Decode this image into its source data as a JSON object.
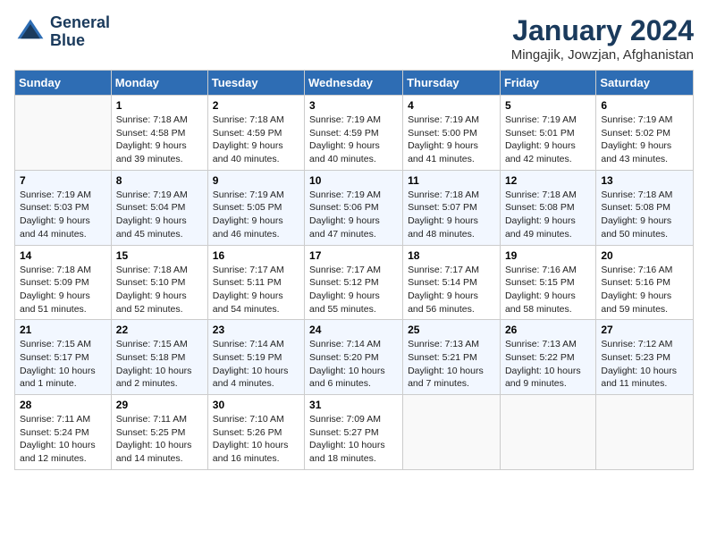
{
  "logo": {
    "line1": "General",
    "line2": "Blue"
  },
  "title": "January 2024",
  "location": "Mingajik, Jowzjan, Afghanistan",
  "weekdays": [
    "Sunday",
    "Monday",
    "Tuesday",
    "Wednesday",
    "Thursday",
    "Friday",
    "Saturday"
  ],
  "weeks": [
    [
      {
        "day": "",
        "sunrise": "",
        "sunset": "",
        "daylight": ""
      },
      {
        "day": "1",
        "sunrise": "Sunrise: 7:18 AM",
        "sunset": "Sunset: 4:58 PM",
        "daylight": "Daylight: 9 hours and 39 minutes."
      },
      {
        "day": "2",
        "sunrise": "Sunrise: 7:18 AM",
        "sunset": "Sunset: 4:59 PM",
        "daylight": "Daylight: 9 hours and 40 minutes."
      },
      {
        "day": "3",
        "sunrise": "Sunrise: 7:19 AM",
        "sunset": "Sunset: 4:59 PM",
        "daylight": "Daylight: 9 hours and 40 minutes."
      },
      {
        "day": "4",
        "sunrise": "Sunrise: 7:19 AM",
        "sunset": "Sunset: 5:00 PM",
        "daylight": "Daylight: 9 hours and 41 minutes."
      },
      {
        "day": "5",
        "sunrise": "Sunrise: 7:19 AM",
        "sunset": "Sunset: 5:01 PM",
        "daylight": "Daylight: 9 hours and 42 minutes."
      },
      {
        "day": "6",
        "sunrise": "Sunrise: 7:19 AM",
        "sunset": "Sunset: 5:02 PM",
        "daylight": "Daylight: 9 hours and 43 minutes."
      }
    ],
    [
      {
        "day": "7",
        "sunrise": "Sunrise: 7:19 AM",
        "sunset": "Sunset: 5:03 PM",
        "daylight": "Daylight: 9 hours and 44 minutes."
      },
      {
        "day": "8",
        "sunrise": "Sunrise: 7:19 AM",
        "sunset": "Sunset: 5:04 PM",
        "daylight": "Daylight: 9 hours and 45 minutes."
      },
      {
        "day": "9",
        "sunrise": "Sunrise: 7:19 AM",
        "sunset": "Sunset: 5:05 PM",
        "daylight": "Daylight: 9 hours and 46 minutes."
      },
      {
        "day": "10",
        "sunrise": "Sunrise: 7:19 AM",
        "sunset": "Sunset: 5:06 PM",
        "daylight": "Daylight: 9 hours and 47 minutes."
      },
      {
        "day": "11",
        "sunrise": "Sunrise: 7:18 AM",
        "sunset": "Sunset: 5:07 PM",
        "daylight": "Daylight: 9 hours and 48 minutes."
      },
      {
        "day": "12",
        "sunrise": "Sunrise: 7:18 AM",
        "sunset": "Sunset: 5:08 PM",
        "daylight": "Daylight: 9 hours and 49 minutes."
      },
      {
        "day": "13",
        "sunrise": "Sunrise: 7:18 AM",
        "sunset": "Sunset: 5:08 PM",
        "daylight": "Daylight: 9 hours and 50 minutes."
      }
    ],
    [
      {
        "day": "14",
        "sunrise": "Sunrise: 7:18 AM",
        "sunset": "Sunset: 5:09 PM",
        "daylight": "Daylight: 9 hours and 51 minutes."
      },
      {
        "day": "15",
        "sunrise": "Sunrise: 7:18 AM",
        "sunset": "Sunset: 5:10 PM",
        "daylight": "Daylight: 9 hours and 52 minutes."
      },
      {
        "day": "16",
        "sunrise": "Sunrise: 7:17 AM",
        "sunset": "Sunset: 5:11 PM",
        "daylight": "Daylight: 9 hours and 54 minutes."
      },
      {
        "day": "17",
        "sunrise": "Sunrise: 7:17 AM",
        "sunset": "Sunset: 5:12 PM",
        "daylight": "Daylight: 9 hours and 55 minutes."
      },
      {
        "day": "18",
        "sunrise": "Sunrise: 7:17 AM",
        "sunset": "Sunset: 5:14 PM",
        "daylight": "Daylight: 9 hours and 56 minutes."
      },
      {
        "day": "19",
        "sunrise": "Sunrise: 7:16 AM",
        "sunset": "Sunset: 5:15 PM",
        "daylight": "Daylight: 9 hours and 58 minutes."
      },
      {
        "day": "20",
        "sunrise": "Sunrise: 7:16 AM",
        "sunset": "Sunset: 5:16 PM",
        "daylight": "Daylight: 9 hours and 59 minutes."
      }
    ],
    [
      {
        "day": "21",
        "sunrise": "Sunrise: 7:15 AM",
        "sunset": "Sunset: 5:17 PM",
        "daylight": "Daylight: 10 hours and 1 minute."
      },
      {
        "day": "22",
        "sunrise": "Sunrise: 7:15 AM",
        "sunset": "Sunset: 5:18 PM",
        "daylight": "Daylight: 10 hours and 2 minutes."
      },
      {
        "day": "23",
        "sunrise": "Sunrise: 7:14 AM",
        "sunset": "Sunset: 5:19 PM",
        "daylight": "Daylight: 10 hours and 4 minutes."
      },
      {
        "day": "24",
        "sunrise": "Sunrise: 7:14 AM",
        "sunset": "Sunset: 5:20 PM",
        "daylight": "Daylight: 10 hours and 6 minutes."
      },
      {
        "day": "25",
        "sunrise": "Sunrise: 7:13 AM",
        "sunset": "Sunset: 5:21 PM",
        "daylight": "Daylight: 10 hours and 7 minutes."
      },
      {
        "day": "26",
        "sunrise": "Sunrise: 7:13 AM",
        "sunset": "Sunset: 5:22 PM",
        "daylight": "Daylight: 10 hours and 9 minutes."
      },
      {
        "day": "27",
        "sunrise": "Sunrise: 7:12 AM",
        "sunset": "Sunset: 5:23 PM",
        "daylight": "Daylight: 10 hours and 11 minutes."
      }
    ],
    [
      {
        "day": "28",
        "sunrise": "Sunrise: 7:11 AM",
        "sunset": "Sunset: 5:24 PM",
        "daylight": "Daylight: 10 hours and 12 minutes."
      },
      {
        "day": "29",
        "sunrise": "Sunrise: 7:11 AM",
        "sunset": "Sunset: 5:25 PM",
        "daylight": "Daylight: 10 hours and 14 minutes."
      },
      {
        "day": "30",
        "sunrise": "Sunrise: 7:10 AM",
        "sunset": "Sunset: 5:26 PM",
        "daylight": "Daylight: 10 hours and 16 minutes."
      },
      {
        "day": "31",
        "sunrise": "Sunrise: 7:09 AM",
        "sunset": "Sunset: 5:27 PM",
        "daylight": "Daylight: 10 hours and 18 minutes."
      },
      {
        "day": "",
        "sunrise": "",
        "sunset": "",
        "daylight": ""
      },
      {
        "day": "",
        "sunrise": "",
        "sunset": "",
        "daylight": ""
      },
      {
        "day": "",
        "sunrise": "",
        "sunset": "",
        "daylight": ""
      }
    ]
  ]
}
